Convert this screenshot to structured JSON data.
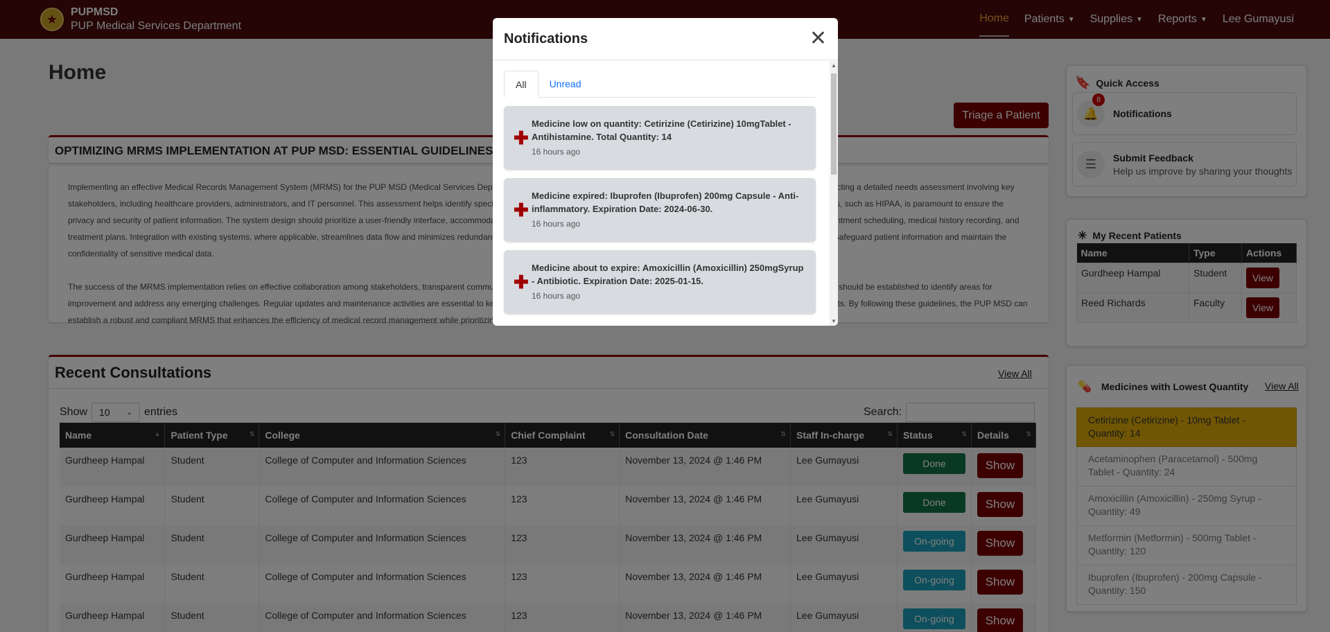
{
  "nav": {
    "brand_short": "PUPMSD",
    "brand_long": "PUP Medical Services Department",
    "items": [
      {
        "label": "Home",
        "active": true,
        "dropdown": false
      },
      {
        "label": "Patients",
        "active": false,
        "dropdown": true
      },
      {
        "label": "Supplies",
        "active": false,
        "dropdown": true
      },
      {
        "label": "Reports",
        "active": false,
        "dropdown": true
      },
      {
        "label": "Lee Gumayusi",
        "active": false,
        "dropdown": false
      }
    ]
  },
  "page": {
    "title": "Home",
    "triage_label": "Triage a Patient"
  },
  "guidelines": {
    "heading": "OPTIMIZING MRMS IMPLEMENTATION AT PUP MSD: ESSENTIAL GUIDELINES",
    "p1": "Implementing an effective Medical Records Management System (MRMS) for the PUP MSD (Medical Services Department) requires careful planning and adherence to essential guidelines. It begins with conducting a detailed needs assessment involving key stakeholders, including healthcare providers, administrators, and IT personnel. This assessment helps identify specific requirements and potential challenges. Compliance with relevant regulations and standards, such as HIPAA, is paramount to ensure the privacy and security of patient information. The system design should prioritize a user-friendly interface, accommodating diverse user needs and supporting essential functions such as patient registration, appointment scheduling, medical history recording, and treatment plans. Integration with existing systems, where applicable, streamlines data flow and minimizes redundancy. Throughout the implementation process, data security measures must be implemented to safeguard patient information and maintain the confidentiality of sensitive medical data.",
    "p2": "The success of the MRMS implementation relies on effective collaboration among stakeholders, transparent communication, and comprehensive staff training. Continuous monitoring and feedback mechanisms should be established to identify areas for improvement and address any emerging challenges. Regular updates and maintenance activities are essential to keep the system current and aligned with evolving requirements and technological advancements. By following these guidelines, the PUP MSD can establish a robust and compliant MRMS that enhances the efficiency of medical record management while prioritizing patient privacy and security."
  },
  "consultations": {
    "title": "Recent Consultations",
    "view_all": "View All",
    "show_label": "Show",
    "entries_value": "10",
    "entries_label": "entries",
    "search_label": "Search:",
    "columns": [
      "Name",
      "Patient Type",
      "College",
      "Chief Complaint",
      "Consultation Date",
      "Staff In-charge",
      "Status",
      "Details"
    ],
    "rows": [
      {
        "name": "Gurdheep Hampal",
        "type": "Student",
        "college": "College of Computer and Information Sciences",
        "complaint": "123",
        "date": "November 13, 2024 @ 1:46 PM",
        "staff": "Lee Gumayusi",
        "status": "Done",
        "status_kind": "done",
        "details": "Show"
      },
      {
        "name": "Gurdheep Hampal",
        "type": "Student",
        "college": "College of Computer and Information Sciences",
        "complaint": "123",
        "date": "November 13, 2024 @ 1:46 PM",
        "staff": "Lee Gumayusi",
        "status": "Done",
        "status_kind": "done",
        "details": "Show"
      },
      {
        "name": "Gurdheep Hampal",
        "type": "Student",
        "college": "College of Computer and Information Sciences",
        "complaint": "123",
        "date": "November 13, 2024 @ 1:46 PM",
        "staff": "Lee Gumayusi",
        "status": "On-going",
        "status_kind": "ongoing",
        "details": "Show"
      },
      {
        "name": "Gurdheep Hampal",
        "type": "Student",
        "college": "College of Computer and Information Sciences",
        "complaint": "123",
        "date": "November 13, 2024 @ 1:46 PM",
        "staff": "Lee Gumayusi",
        "status": "On-going",
        "status_kind": "ongoing",
        "details": "Show"
      },
      {
        "name": "Gurdheep Hampal",
        "type": "Student",
        "college": "College of Computer and Information Sciences",
        "complaint": "123",
        "date": "November 13, 2024 @ 1:46 PM",
        "staff": "Lee Gumayusi",
        "status": "On-going",
        "status_kind": "ongoing",
        "details": "Show"
      }
    ]
  },
  "quick_access": {
    "title": "Quick Access",
    "notifications_label": "Notifications",
    "notifications_badge": "8",
    "feedback_label": "Submit Feedback",
    "feedback_sub": "Help us improve by sharing your thoughts"
  },
  "recent_patients": {
    "title": "My Recent Patients",
    "columns": [
      "Name",
      "Type",
      "Actions"
    ],
    "rows": [
      {
        "name": "Gurdheep Hampal",
        "type": "Student",
        "action": "View"
      },
      {
        "name": "Reed Richards",
        "type": "Faculty",
        "action": "View"
      }
    ]
  },
  "lowest_meds": {
    "title": "Medicines with Lowest Quantity",
    "view_all": "View All",
    "items": [
      {
        "text": "Cetirizine (Cetirizine) - 10mg Tablet - Quantity: 14",
        "highlight": true
      },
      {
        "text": "Acetaminophen (Paracetamol) - 500mg Tablet - Quantity: 24",
        "highlight": false
      },
      {
        "text": "Amoxicillin (Amoxicillin) - 250mg Syrup - Quantity: 49",
        "highlight": false
      },
      {
        "text": "Metformin (Metformin) - 500mg Tablet - Quantity: 120",
        "highlight": false
      },
      {
        "text": "Ibuprofen (Ibuprofen) - 200mg Capsule - Quantity: 150",
        "highlight": false
      }
    ]
  },
  "modal": {
    "title": "Notifications",
    "tabs": [
      {
        "label": "All",
        "active": true
      },
      {
        "label": "Unread",
        "active": false
      }
    ],
    "notifications": [
      {
        "text": "Medicine low on quantity: Cetirizine (Cetirizine) 10mgTablet - Antihistamine. Total Quantity: 14",
        "time": "16 hours ago"
      },
      {
        "text": "Medicine expired: Ibuprofen (Ibuprofen) 200mg Capsule - Anti-inflammatory. Expiration Date: 2024-06-30.",
        "time": "16 hours ago"
      },
      {
        "text": "Medicine about to expire: Amoxicillin (Amoxicillin) 250mgSyrup - Antibiotic. Expiration Date: 2025-01-15.",
        "time": "16 hours ago"
      }
    ]
  },
  "colors": {
    "navbar": "#4a0a0a",
    "accent": "#7a0000",
    "active_nav": "#f2a33a",
    "done": "#157347",
    "ongoing": "#1a9fb8",
    "low_stock": "#e0ad08"
  }
}
